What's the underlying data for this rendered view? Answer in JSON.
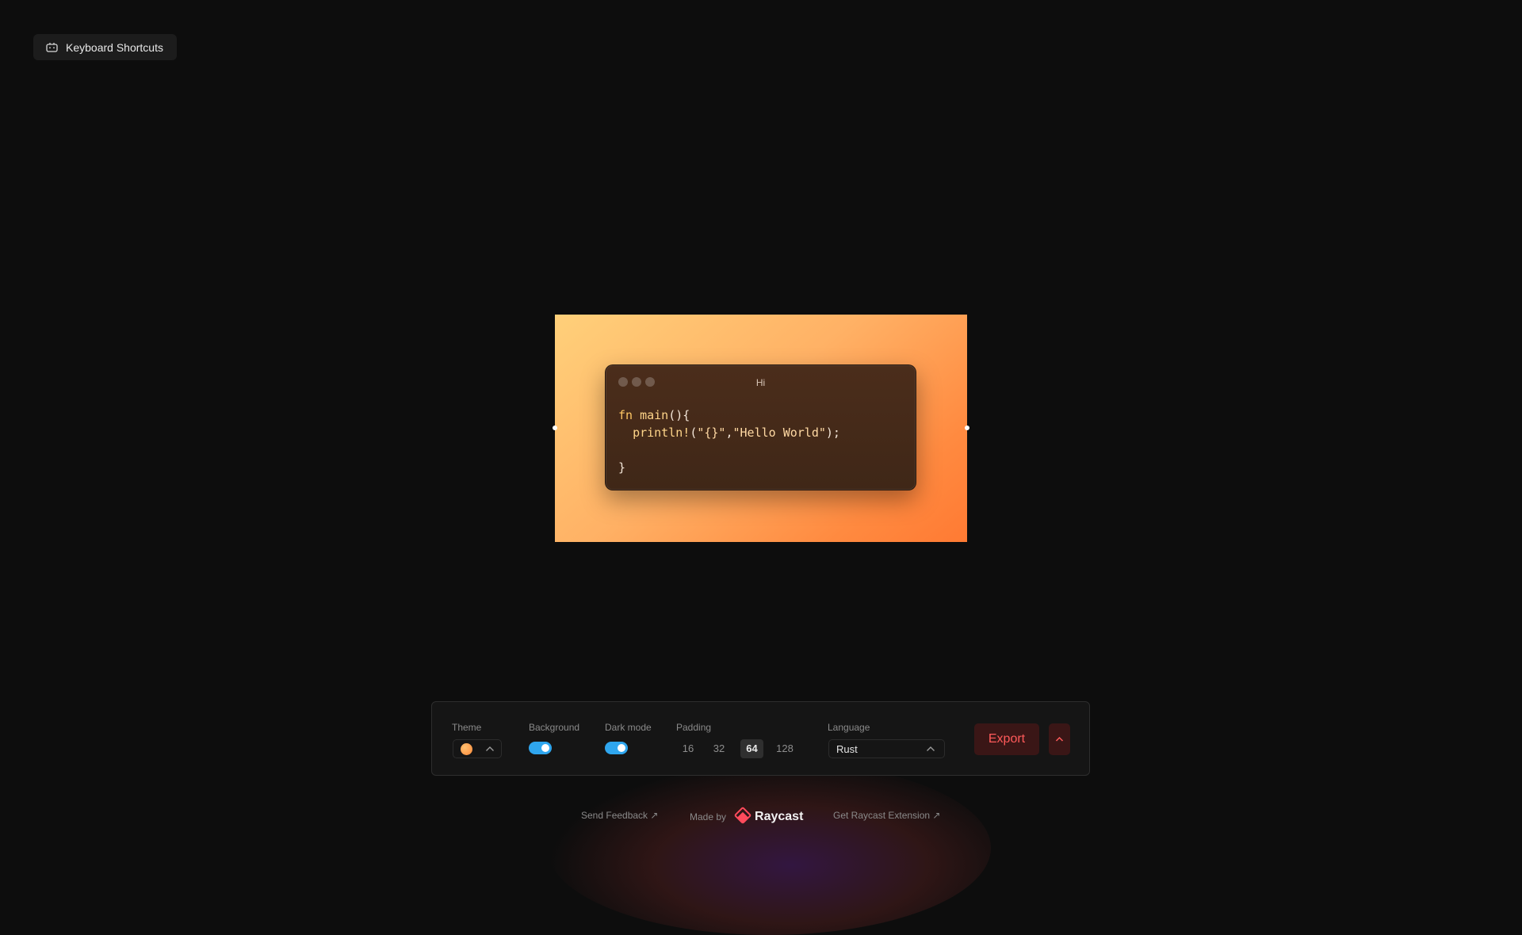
{
  "header": {
    "shortcuts_label": "Keyboard Shortcuts"
  },
  "snippet": {
    "window_title": "Hi",
    "code": {
      "line1_kw": "fn",
      "line1_fn": "main",
      "line1_rest": "(){",
      "line2_fn": "println!",
      "line2_open": "(",
      "line2_str1": "\"{}\"",
      "line2_comma": ",",
      "line2_str2": "\"Hello World\"",
      "line2_close": ");",
      "line4": "}"
    },
    "background_colors": [
      "#ffd07a",
      "#ff7a33"
    ]
  },
  "toolbar": {
    "theme_label": "Theme",
    "theme_swatch_color": "#ff9a45",
    "background_label": "Background",
    "background_on": true,
    "dark_mode_label": "Dark mode",
    "dark_mode_on": true,
    "padding_label": "Padding",
    "padding_options": [
      "16",
      "32",
      "64",
      "128"
    ],
    "padding_selected": "64",
    "language_label": "Language",
    "language_value": "Rust",
    "export_label": "Export"
  },
  "footer": {
    "feedback_label": "Send Feedback ↗",
    "made_by_label": "Made by",
    "brand_name": "Raycast",
    "extension_label": "Get Raycast Extension ↗"
  },
  "colors": {
    "accent_toggle": "#2fa6ee",
    "export_text": "#ff5a5a",
    "brand_red": "#ff4b5c"
  }
}
